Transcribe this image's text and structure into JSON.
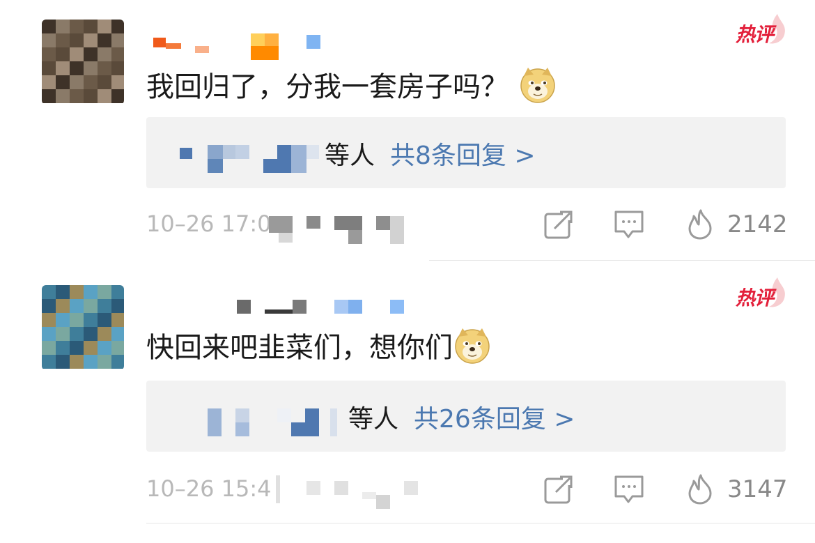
{
  "comments": [
    {
      "hot_label": "热评",
      "text": "我回归了，分我一套房子吗？",
      "reply_suffix": "等人",
      "reply_count": "共8条回复 >",
      "time": "10–26 17:0",
      "likes": "2142",
      "emoji_icon": "doge-emoji",
      "avatar_colors": [
        "#5a4a3a",
        "#8a7a68",
        "#a08c78",
        "#6b5a48",
        "#3e3228"
      ]
    },
    {
      "hot_label": "热评",
      "text": "快回来吧韭菜们，想你们",
      "reply_suffix": "等人",
      "reply_count": "共26条回复 >",
      "time": "10–26 15:4",
      "likes": "3147",
      "emoji_icon": "doge-emoji",
      "avatar_colors": [
        "#3f7e9a",
        "#5aa2c4",
        "#2b5a78",
        "#7aa8a0",
        "#9c8a5a"
      ]
    }
  ],
  "colors": {
    "hot": "#e3203b",
    "link": "#4b78b0",
    "reply_bg": "#f2f2f2",
    "meta": "#b8b8b8"
  },
  "icons": [
    "share-icon",
    "comment-icon",
    "like-flame-icon",
    "hot-flame-icon",
    "doge-emoji"
  ]
}
